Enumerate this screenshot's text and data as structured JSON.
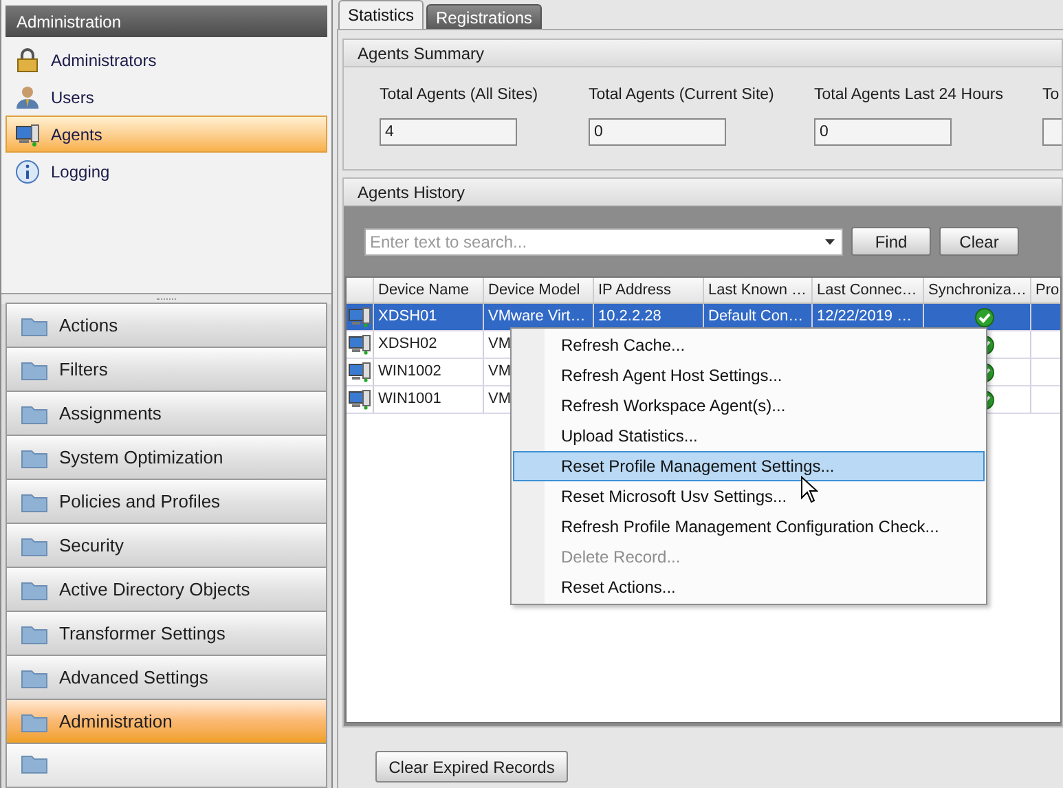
{
  "sidebar": {
    "header": "Administration",
    "items": [
      {
        "label": "Administrators",
        "kind": "lock",
        "selected": false
      },
      {
        "label": "Users",
        "kind": "user",
        "selected": false
      },
      {
        "label": "Agents",
        "kind": "computer",
        "selected": true
      },
      {
        "label": "Logging",
        "kind": "info",
        "selected": false
      }
    ],
    "nav": [
      {
        "label": "Actions",
        "selected": false
      },
      {
        "label": "Filters",
        "selected": false
      },
      {
        "label": "Assignments",
        "selected": false
      },
      {
        "label": "System Optimization",
        "selected": false
      },
      {
        "label": "Policies and Profiles",
        "selected": false
      },
      {
        "label": "Security",
        "selected": false
      },
      {
        "label": "Active Directory Objects",
        "selected": false
      },
      {
        "label": "Transformer Settings",
        "selected": false
      },
      {
        "label": "Advanced Settings",
        "selected": false
      },
      {
        "label": "Administration",
        "selected": true
      }
    ]
  },
  "tabs": [
    {
      "label": "Statistics",
      "selected": true
    },
    {
      "label": "Registrations",
      "selected": false
    }
  ],
  "summary": {
    "title": "Agents Summary",
    "stats": [
      {
        "label": "Total Agents (All Sites)",
        "value": "4"
      },
      {
        "label": "Total Agents (Current Site)",
        "value": "0"
      },
      {
        "label": "Total Agents Last 24 Hours",
        "value": "0"
      },
      {
        "label": "To"
      }
    ]
  },
  "history": {
    "title": "Agents History",
    "search": {
      "placeholder": "Enter text to search..."
    },
    "buttons": [
      "Find",
      "Clear"
    ],
    "columns": [
      "Device Name",
      "Device Model",
      "IP Address",
      "Last Known …",
      "Last Connec…",
      "Synchroniza…",
      "Pro"
    ],
    "rows": [
      {
        "selected": true,
        "synchronized": true,
        "cells": [
          "XDSH01",
          "VMware Virt…",
          "10.2.2.28",
          "Default Con…",
          "12/22/2019 …"
        ]
      },
      {
        "selected": false,
        "synchronized": true,
        "cells": [
          "XDSH02",
          "VM"
        ]
      },
      {
        "selected": false,
        "synchronized": true,
        "cells": [
          "WIN1002",
          "VM"
        ]
      },
      {
        "selected": false,
        "synchronized": true,
        "cells": [
          "WIN1001",
          "VM"
        ]
      }
    ]
  },
  "context_menu": [
    {
      "label": "Refresh Cache...",
      "selected": false,
      "disabled": false
    },
    {
      "label": "Refresh Agent Host Settings...",
      "selected": false,
      "disabled": false
    },
    {
      "label": "Refresh Workspace Agent(s)...",
      "selected": false,
      "disabled": false
    },
    {
      "label": "Upload Statistics...",
      "selected": false,
      "disabled": false
    },
    {
      "label": "Reset Profile Management Settings...",
      "selected": true,
      "disabled": false
    },
    {
      "label": "Reset Microsoft Usv Settings...",
      "selected": false,
      "disabled": false
    },
    {
      "label": "Refresh Profile Management Configuration Check...",
      "selected": false,
      "disabled": false
    },
    {
      "label": "Delete Record...",
      "selected": false,
      "disabled": true
    },
    {
      "label": "Reset Actions...",
      "selected": false,
      "disabled": false
    }
  ],
  "footer_button": "Clear Expired Records"
}
